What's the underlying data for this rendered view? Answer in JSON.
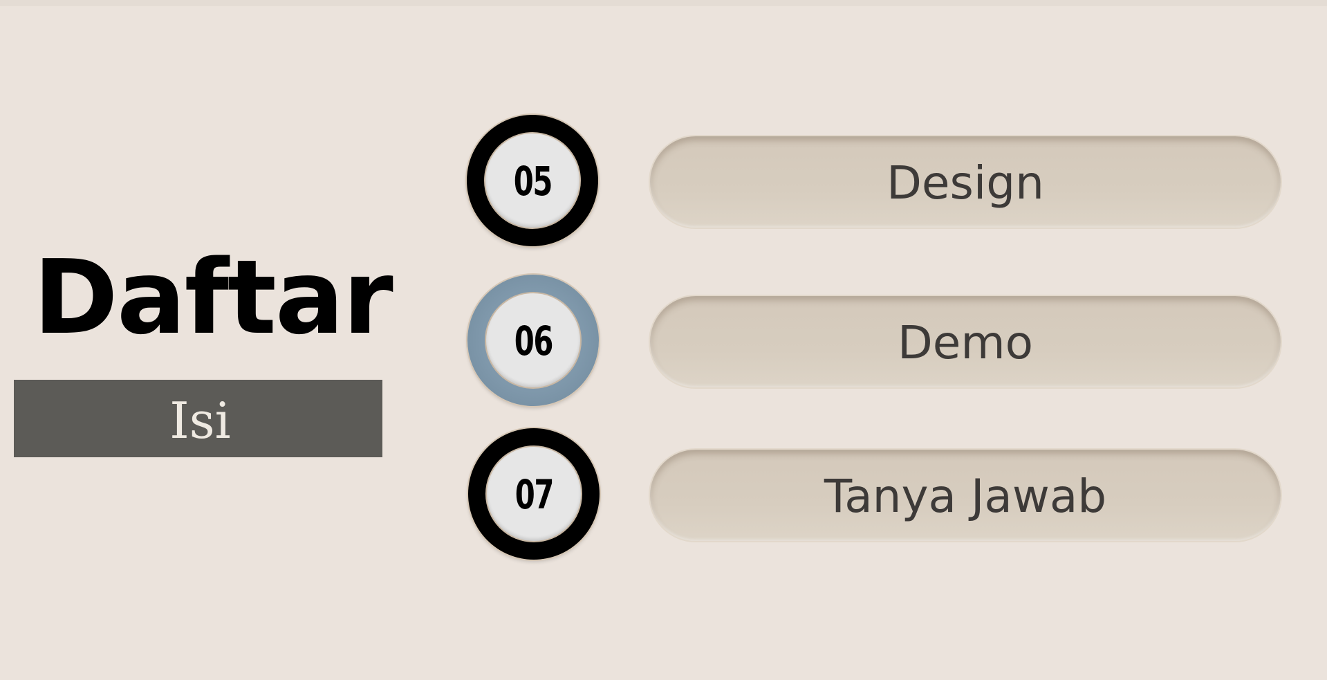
{
  "heading": {
    "title": "Daftar",
    "subtitle": "Isi"
  },
  "items": [
    {
      "number": "05",
      "label": "Design",
      "active": false
    },
    {
      "number": "06",
      "label": "Demo",
      "active": true
    },
    {
      "number": "07",
      "label": "Tanya Jawab",
      "active": false
    }
  ],
  "colors": {
    "background": "#ebe3dc",
    "subtitle_box": "#5c5b57",
    "ring_default": "#000000",
    "ring_active": "#7f98ab",
    "pill": "#d7cdbf",
    "pill_text": "#3d3a38"
  }
}
